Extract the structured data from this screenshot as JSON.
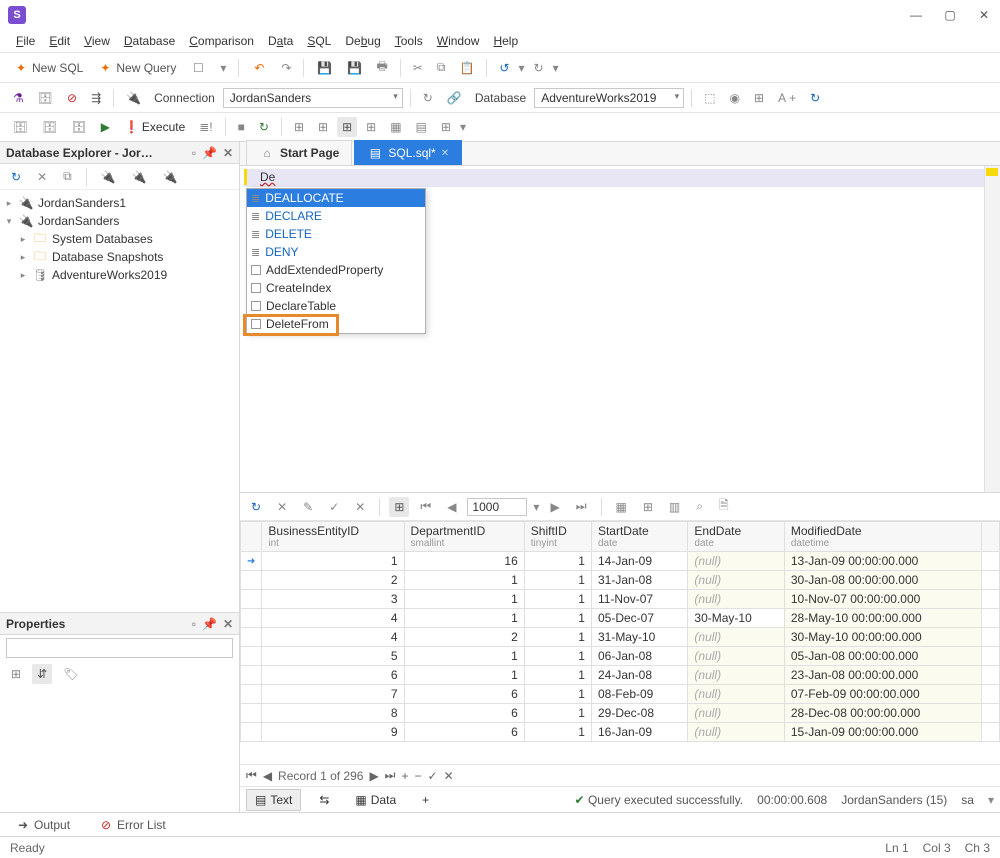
{
  "window": {
    "min": "—",
    "max": "▢",
    "close": "✕"
  },
  "menu": [
    "File",
    "Edit",
    "View",
    "Database",
    "Comparison",
    "Data",
    "SQL",
    "Debug",
    "Tools",
    "Window",
    "Help"
  ],
  "tb1": {
    "newSql": "New SQL",
    "newQuery": "New Query"
  },
  "tb2": {
    "connLabel": "Connection",
    "connValue": "JordanSanders",
    "dbLabel": "Database",
    "dbValue": "AdventureWorks2019"
  },
  "tb3": {
    "execute": "Execute"
  },
  "explorer": {
    "title": "Database Explorer - Jor…",
    "nodes": {
      "n1": "JordanSanders1",
      "n2": "JordanSanders",
      "n3": "System Databases",
      "n4": "Database Snapshots",
      "n5": "AdventureWorks2019"
    }
  },
  "props": {
    "title": "Properties"
  },
  "tabs": {
    "start": "Start Page",
    "sql": "SQL.sql*"
  },
  "editor": {
    "typed": "De"
  },
  "ac": {
    "i1": "DEALLOCATE",
    "i2": "DECLARE",
    "i3": "DELETE",
    "i4": "DENY",
    "i5": "AddExtendedProperty",
    "i6": "CreateIndex",
    "i7": "DeclareTable",
    "i8": "DeleteFrom"
  },
  "gridTool": {
    "page": "1000"
  },
  "cols": {
    "c1": "BusinessEntityID",
    "c1t": "int",
    "c2": "DepartmentID",
    "c2t": "smallint",
    "c3": "ShiftID",
    "c3t": "tinyint",
    "c4": "StartDate",
    "c4t": "date",
    "c5": "EndDate",
    "c5t": "date",
    "c6": "ModifiedDate",
    "c6t": "datetime"
  },
  "rows": [
    {
      "be": "1",
      "dep": "16",
      "sh": "1",
      "sd": "14-Jan-09",
      "ed": "(null)",
      "md": "13-Jan-09 00:00:00.000"
    },
    {
      "be": "2",
      "dep": "1",
      "sh": "1",
      "sd": "31-Jan-08",
      "ed": "(null)",
      "md": "30-Jan-08 00:00:00.000"
    },
    {
      "be": "3",
      "dep": "1",
      "sh": "1",
      "sd": "11-Nov-07",
      "ed": "(null)",
      "md": "10-Nov-07 00:00:00.000"
    },
    {
      "be": "4",
      "dep": "1",
      "sh": "1",
      "sd": "05-Dec-07",
      "ed": "30-May-10",
      "md": "28-May-10 00:00:00.000"
    },
    {
      "be": "4",
      "dep": "2",
      "sh": "1",
      "sd": "31-May-10",
      "ed": "(null)",
      "md": "30-May-10 00:00:00.000"
    },
    {
      "be": "5",
      "dep": "1",
      "sh": "1",
      "sd": "06-Jan-08",
      "ed": "(null)",
      "md": "05-Jan-08 00:00:00.000"
    },
    {
      "be": "6",
      "dep": "1",
      "sh": "1",
      "sd": "24-Jan-08",
      "ed": "(null)",
      "md": "23-Jan-08 00:00:00.000"
    },
    {
      "be": "7",
      "dep": "6",
      "sh": "1",
      "sd": "08-Feb-09",
      "ed": "(null)",
      "md": "07-Feb-09 00:00:00.000"
    },
    {
      "be": "8",
      "dep": "6",
      "sh": "1",
      "sd": "29-Dec-08",
      "ed": "(null)",
      "md": "28-Dec-08 00:00:00.000"
    },
    {
      "be": "9",
      "dep": "6",
      "sh": "1",
      "sd": "16-Jan-09",
      "ed": "(null)",
      "md": "15-Jan-09 00:00:00.000"
    }
  ],
  "nav": {
    "rec": "Record 1 of 296"
  },
  "res": {
    "text": "Text",
    "data": "Data",
    "ok": "Query executed successfully.",
    "time": "00:00:00.608",
    "conn": "JordanSanders (15)",
    "user": "sa"
  },
  "bottom": {
    "output": "Output",
    "errors": "Error List"
  },
  "status": {
    "ready": "Ready",
    "ln": "Ln 1",
    "col": "Col 3",
    "ch": "Ch 3"
  }
}
